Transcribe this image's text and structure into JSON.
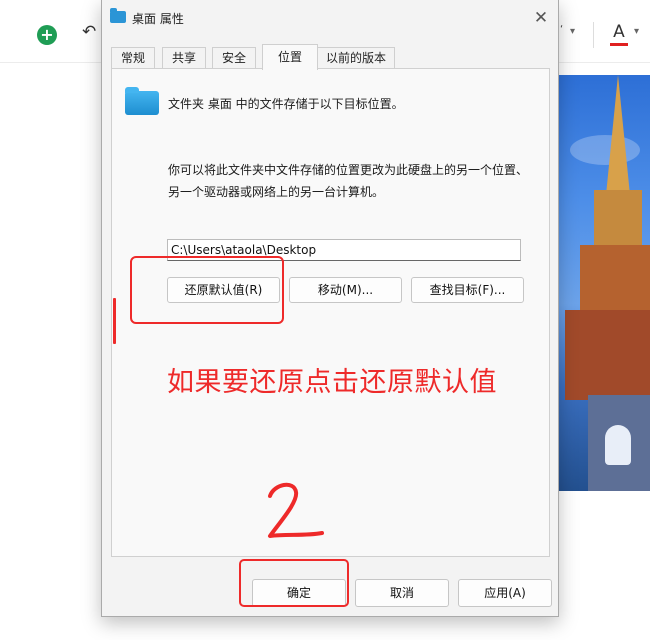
{
  "app": {
    "toolbar": {
      "add_icon": "plus-circle-icon",
      "undo_icon": "undo-icon",
      "font_color_label": "A",
      "font_color_accent": "#e02020",
      "dropdown_glyph": "▾"
    }
  },
  "dialog": {
    "title": "桌面 属性",
    "close_glyph": "✕",
    "tabs": [
      {
        "label": "常规"
      },
      {
        "label": "共享"
      },
      {
        "label": "安全"
      },
      {
        "label": "位置",
        "active": true
      },
      {
        "label": "以前的版本"
      }
    ],
    "location": {
      "info": "文件夹 桌面 中的文件存储于以下目标位置。",
      "description": "你可以将此文件夹中文件存储的位置更改为此硬盘上的另一个位置、另一个驱动器或网络上的另一台计算机。",
      "path_value": "C:\\Users\\ataola\\Desktop",
      "restore_button": "还原默认值(R)",
      "move_button": "移动(M)...",
      "find_target_button": "查找目标(F)..."
    },
    "footer": {
      "ok_button": "确定",
      "cancel_button": "取消",
      "apply_button": "应用(A)"
    }
  },
  "annotations": {
    "color": "#ee2a2a",
    "step_one_mark": "1",
    "instruction": "如果要还原点击还原默认值",
    "step_two_mark": "2"
  }
}
